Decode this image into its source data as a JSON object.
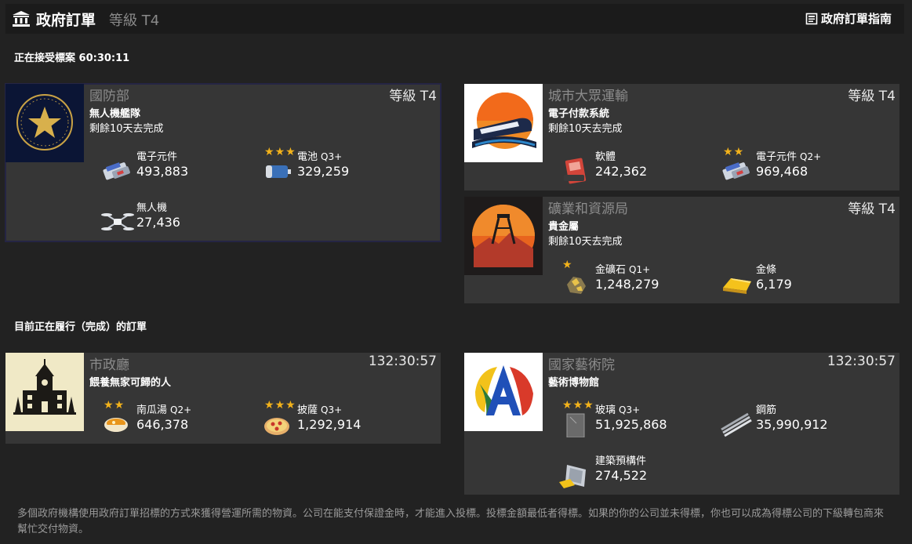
{
  "header": {
    "title": "政府訂單",
    "tier": "等級 T4",
    "guide_label": "政府訂單指南"
  },
  "bidding": {
    "label": "正在接受標案 60:30:11"
  },
  "active": {
    "label": "目前正在履行（完成）的訂單"
  },
  "orders": [
    {
      "agency": "國防部",
      "level": "等級 T4",
      "project": "無人機艦隊",
      "remaining": "剩餘10天去完成",
      "items": [
        {
          "name": "電子元件",
          "quality": "",
          "stars": 0,
          "qty": "493,883",
          "icon": "electronic-components-icon"
        },
        {
          "name": "電池",
          "quality": "Q3+",
          "stars": 3,
          "qty": "329,259",
          "icon": "battery-icon"
        },
        {
          "name": "無人機",
          "quality": "",
          "stars": 0,
          "qty": "27,436",
          "icon": "drone-icon"
        }
      ]
    },
    {
      "agency": "城市大眾運輸",
      "level": "等級 T4",
      "project": "電子付款系統",
      "remaining": "剩餘10天去完成",
      "items": [
        {
          "name": "軟體",
          "quality": "",
          "stars": 0,
          "qty": "242,362",
          "icon": "software-icon"
        },
        {
          "name": "電子元件",
          "quality": "Q2+",
          "stars": 2,
          "qty": "969,468",
          "icon": "electronic-components-icon"
        }
      ]
    },
    {
      "agency": "礦業和資源局",
      "level": "等級 T4",
      "project": "貴金屬",
      "remaining": "剩餘10天去完成",
      "items": [
        {
          "name": "金礦石",
          "quality": "Q1+",
          "stars": 1,
          "qty": "1,248,279",
          "icon": "gold-ore-icon"
        },
        {
          "name": "金條",
          "quality": "",
          "stars": 0,
          "qty": "6,179",
          "icon": "gold-bar-icon"
        }
      ]
    },
    {
      "agency": "市政廳",
      "level": "132:30:57",
      "project": "餵養無家可歸的人",
      "remaining": "",
      "items": [
        {
          "name": "南瓜湯",
          "quality": "Q2+",
          "stars": 2,
          "qty": "646,378",
          "icon": "pumpkin-soup-icon"
        },
        {
          "name": "披薩",
          "quality": "Q3+",
          "stars": 3,
          "qty": "1,292,914",
          "icon": "pizza-icon"
        }
      ]
    },
    {
      "agency": "國家藝術院",
      "level": "132:30:57",
      "project": "藝術博物館",
      "remaining": "",
      "items": [
        {
          "name": "玻璃",
          "quality": "Q3+",
          "stars": 3,
          "qty": "51,925,868",
          "icon": "glass-icon"
        },
        {
          "name": "鋼筋",
          "quality": "",
          "stars": 0,
          "qty": "35,990,912",
          "icon": "rebar-icon"
        },
        {
          "name": "建築預構件",
          "quality": "",
          "stars": 0,
          "qty": "274,522",
          "icon": "prefab-panels-icon"
        }
      ]
    }
  ],
  "footer": {
    "text": "多個政府機構使用政府訂單招標的方式來獲得營運所需的物資。公司在能支付保證金時，才能進入投標。投標金額最低者得標。如果的你的公司並未得標，你也可以成為得標公司的下級轉包商來幫忙交付物資。"
  }
}
